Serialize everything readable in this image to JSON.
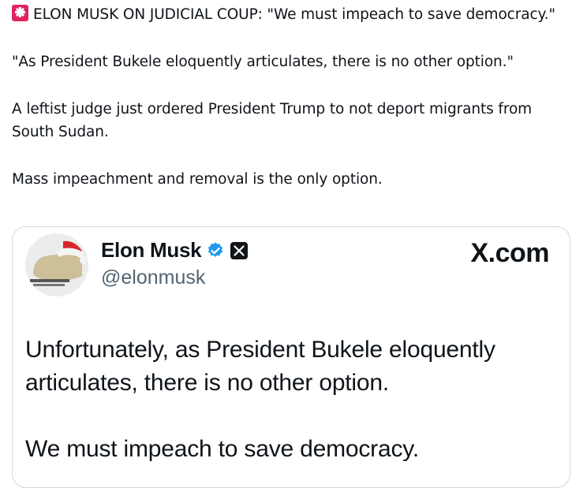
{
  "post": {
    "headline": "ELON MUSK ON JUDICIAL COUP: \"We must impeach to save democracy.\"",
    "quote": "\"As President Bukele eloquently articulates, there is no other option.\"",
    "paragraph1": "A leftist judge just ordered President Trump to not deport migrants from South Sudan.",
    "paragraph2": "Mass impeachment and removal is the only option.",
    "emoji": "rotating-light-icon"
  },
  "card": {
    "display_name": "Elon Musk",
    "handle": "@elonmusk",
    "brand": "X.com",
    "tweet_line1": "Unfortunately, as President Bukele eloquently articulates, there is no other option.",
    "tweet_line2": "We must impeach to save democracy.",
    "colors": {
      "verified": "#1d9bf0",
      "handle": "#536471",
      "border": "#cfd9de",
      "siren": "#e0245e"
    }
  }
}
